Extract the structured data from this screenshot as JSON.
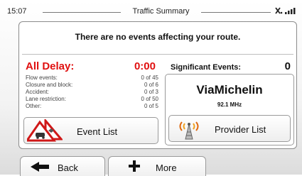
{
  "status_bar": {
    "time": "15:07",
    "title": "Traffic Summary",
    "signal_icon": "satellite-signal-icon"
  },
  "summary": {
    "message": "There are no events affecting your route.",
    "all_delay_label": "All Delay:",
    "all_delay_value": "0:00",
    "events": [
      {
        "label": "Flow events:",
        "value": "0 of 45"
      },
      {
        "label": "Closure and block:",
        "value": "0 of 6"
      },
      {
        "label": "Accident:",
        "value": "0 of 3"
      },
      {
        "label": "Lane restriction:",
        "value": "0 of 50"
      },
      {
        "label": "Other:",
        "value": "0 of 5"
      }
    ],
    "significant_label": "Significant Events:",
    "significant_value": "0"
  },
  "event_list_button": {
    "label": "Event List",
    "icon": "warning-signs-icon"
  },
  "provider": {
    "name": "ViaMichelin",
    "frequency": "92.1 MHz",
    "button_label": "Provider List",
    "icon": "radio-tower-icon"
  },
  "bottom_bar": {
    "back_label": "Back",
    "back_icon": "back-arrow-icon",
    "more_label": "More",
    "more_icon": "plus-icon"
  },
  "colors": {
    "delay": "#e01010",
    "border": "#8c8c8c"
  }
}
